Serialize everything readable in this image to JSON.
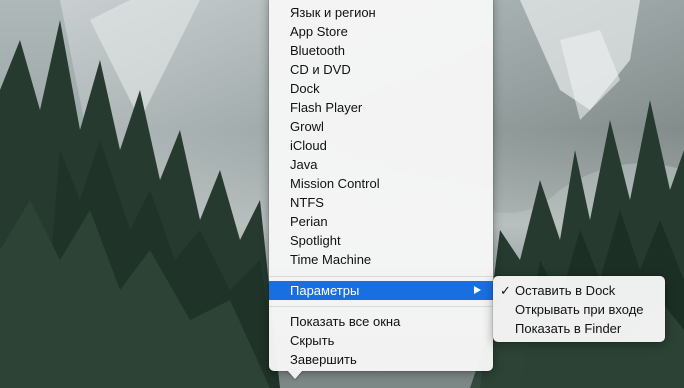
{
  "main_menu": {
    "items": [
      {
        "label": "Язык и регион"
      },
      {
        "label": "App Store"
      },
      {
        "label": "Bluetooth"
      },
      {
        "label": "CD и DVD"
      },
      {
        "label": "Dock"
      },
      {
        "label": "Flash Player"
      },
      {
        "label": "Growl"
      },
      {
        "label": "iCloud"
      },
      {
        "label": "Java"
      },
      {
        "label": "Mission Control"
      },
      {
        "label": "NTFS"
      },
      {
        "label": "Perian"
      },
      {
        "label": "Spotlight"
      },
      {
        "label": "Time Machine"
      }
    ],
    "parameters_label": "Параметры",
    "show_all_label": "Показать все окна",
    "hide_label": "Скрыть",
    "quit_label": "Завершить"
  },
  "submenu": {
    "items": [
      {
        "label": "Оставить в Dock",
        "checked": true,
        "check": "✓"
      },
      {
        "label": "Открывать при входе",
        "checked": false
      },
      {
        "label": "Показать в Finder",
        "checked": false
      }
    ]
  },
  "colors": {
    "highlight": "#1a6fe0",
    "menu_background": "#f6f6f6"
  }
}
